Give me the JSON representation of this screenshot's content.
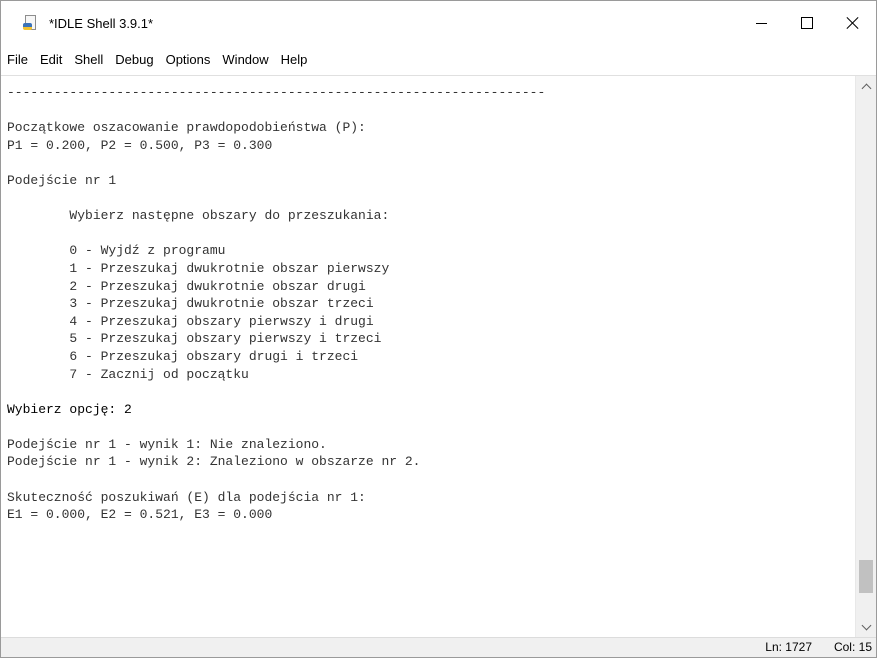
{
  "window": {
    "title": "*IDLE Shell 3.9.1*"
  },
  "menu": [
    {
      "label": "File",
      "name": "menu-file"
    },
    {
      "label": "Edit",
      "name": "menu-edit"
    },
    {
      "label": "Shell",
      "name": "menu-shell"
    },
    {
      "label": "Debug",
      "name": "menu-debug"
    },
    {
      "label": "Options",
      "name": "menu-options"
    },
    {
      "label": "Window",
      "name": "menu-window"
    },
    {
      "label": "Help",
      "name": "menu-help"
    }
  ],
  "shell_lines": [
    {
      "text": "---------------------------------------------------------------------",
      "style": "stdout"
    },
    {
      "text": "",
      "style": "stdout"
    },
    {
      "text": "Początkowe oszacowanie prawdopodobieństwa (P):",
      "style": "stdout"
    },
    {
      "text": "P1 = 0.200, P2 = 0.500, P3 = 0.300",
      "style": "stdout"
    },
    {
      "text": "",
      "style": "stdout"
    },
    {
      "text": "Podejście nr 1",
      "style": "stdout"
    },
    {
      "text": "",
      "style": "stdout"
    },
    {
      "text": "        Wybierz następne obszary do przeszukania:",
      "style": "stdout"
    },
    {
      "text": "",
      "style": "stdout"
    },
    {
      "text": "        0 - Wyjdź z programu",
      "style": "stdout"
    },
    {
      "text": "        1 - Przeszukaj dwukrotnie obszar pierwszy",
      "style": "stdout"
    },
    {
      "text": "        2 - Przeszukaj dwukrotnie obszar drugi",
      "style": "stdout"
    },
    {
      "text": "        3 - Przeszukaj dwukrotnie obszar trzeci",
      "style": "stdout"
    },
    {
      "text": "        4 - Przeszukaj obszary pierwszy i drugi",
      "style": "stdout"
    },
    {
      "text": "        5 - Przeszukaj obszary pierwszy i trzeci",
      "style": "stdout"
    },
    {
      "text": "        6 - Przeszukaj obszary drugi i trzeci",
      "style": "stdout"
    },
    {
      "text": "        7 - Zacznij od początku",
      "style": "stdout"
    },
    {
      "text": "",
      "style": "stdout"
    },
    {
      "text": "Wybierz opcję: 2",
      "style": "in"
    },
    {
      "text": "",
      "style": "stdout"
    },
    {
      "text": "Podejście nr 1 - wynik 1: Nie znaleziono.",
      "style": "stdout"
    },
    {
      "text": "Podejście nr 1 - wynik 2: Znaleziono w obszarze nr 2.",
      "style": "stdout"
    },
    {
      "text": "",
      "style": "stdout"
    },
    {
      "text": "Skuteczność poszukiwań (E) dla podejścia nr 1:",
      "style": "stdout"
    },
    {
      "text": "E1 = 0.000, E2 = 0.521, E3 = 0.000",
      "style": "stdout"
    }
  ],
  "status": {
    "line": "Ln: 1727",
    "col": "Col: 15"
  },
  "scroll_position": 0.95
}
